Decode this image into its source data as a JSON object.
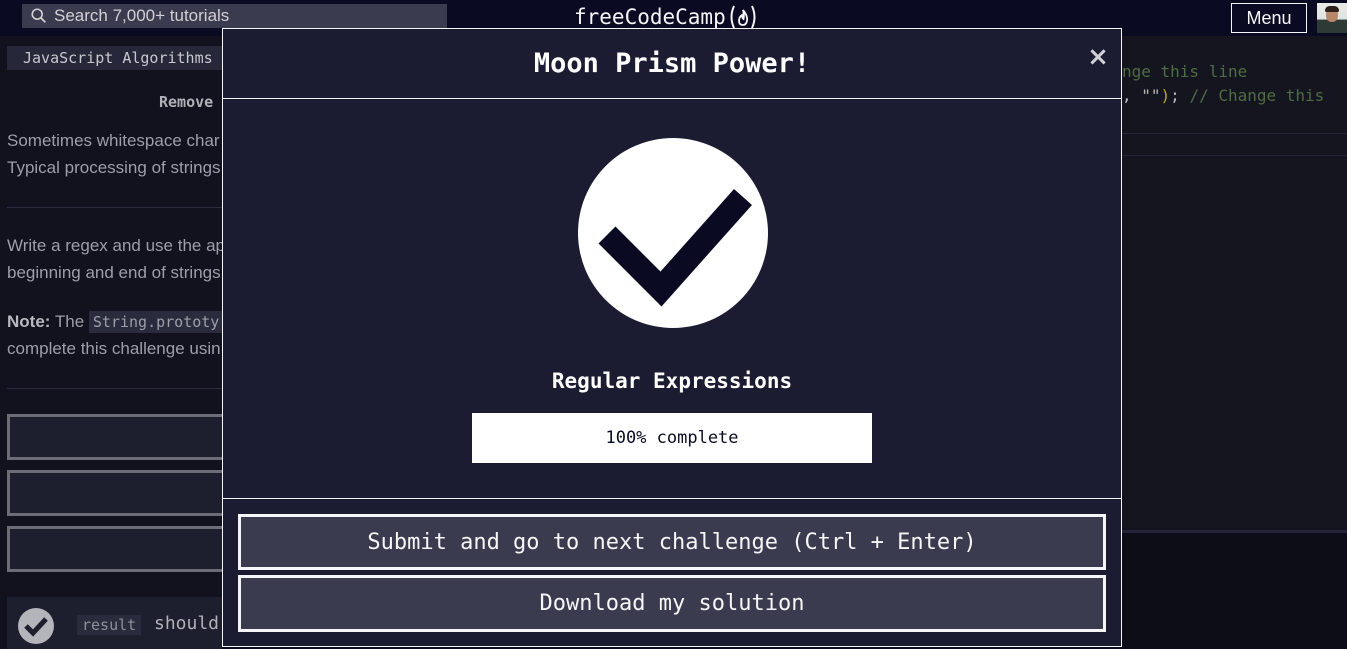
{
  "navbar": {
    "search_placeholder": "Search 7,000+ tutorials",
    "brand": "freeCodeCamp",
    "menu_label": "Menu"
  },
  "left_pane": {
    "breadcrumb": "JavaScript Algorithms",
    "challenge_title": "Remove",
    "para1_line1": "Sometimes whitespace char",
    "para1_line2": "Typical processing of strings",
    "para2_line1": "Write a regex and use the ap",
    "para2_line2": "beginning and end of strings",
    "note_label": "Note:",
    "note_text": " The ",
    "note_code": "String.prototy",
    "note_line2": "complete this challenge usin",
    "test_code": "result",
    "test_text": "should"
  },
  "editor": {
    "line1_comment": "nge this line",
    "line2_str": ", \"\"",
    "line2_paren": ")",
    "line2_semi": "; ",
    "line2_comment": "// Change this"
  },
  "modal": {
    "title": "Moon Prism Power!",
    "close_symbol": "×",
    "block_title": "Regular Expressions",
    "progress_percent": 100,
    "progress_text": "100% complete",
    "submit_button": "Submit and go to next challenge (Ctrl + Enter)",
    "download_button": "Download my solution"
  },
  "icons": {
    "search": "search-icon",
    "flame": "fcc-flame-icon",
    "close": "close-icon",
    "check": "check-circle-icon"
  },
  "colors": {
    "background": "#0a0a23",
    "modal_bg": "#1b1b32",
    "button_bg": "#3b3b4f",
    "text": "#f5f6f7"
  }
}
